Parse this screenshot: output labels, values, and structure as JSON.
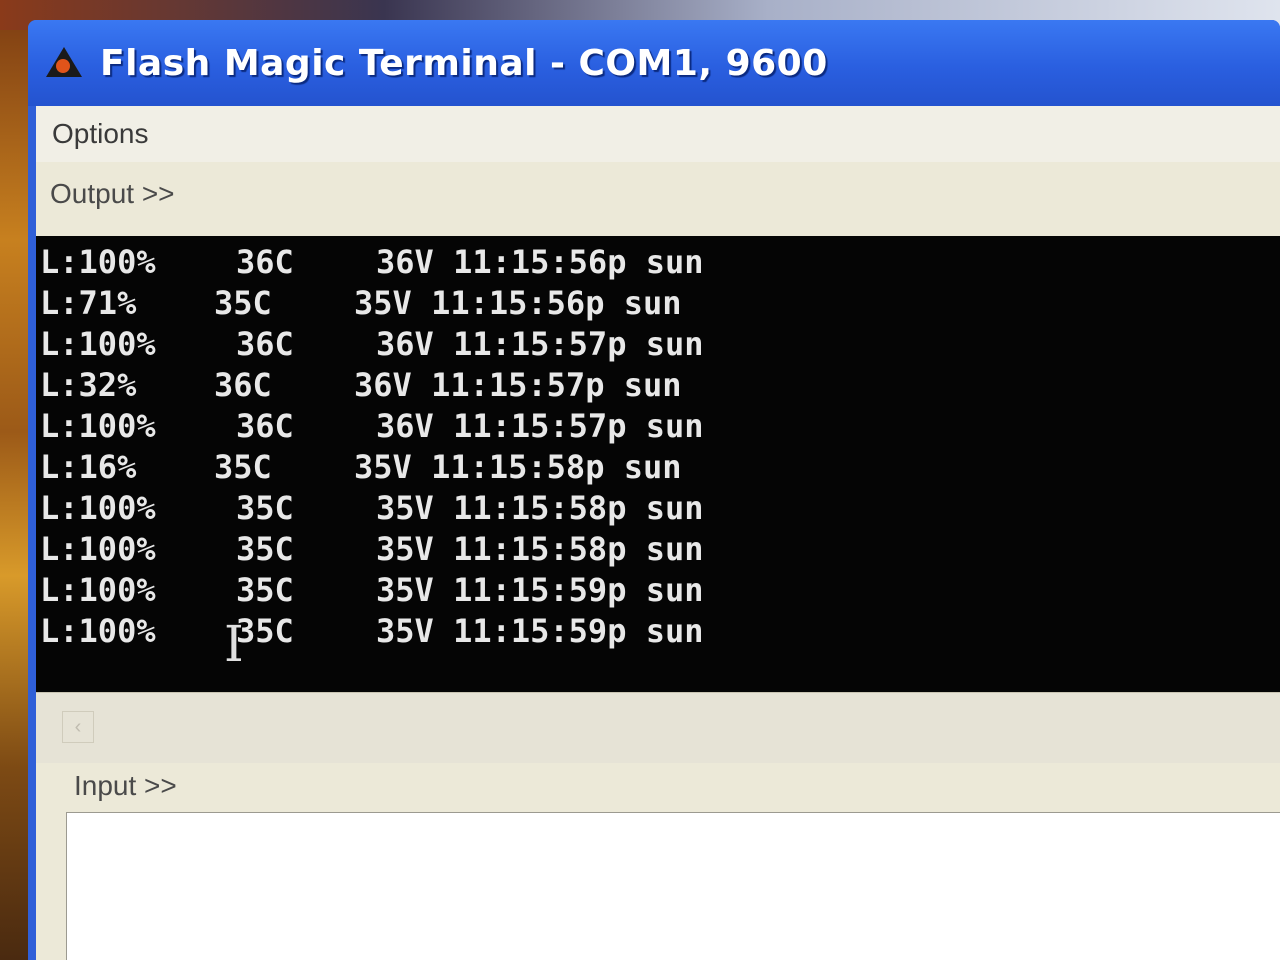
{
  "window": {
    "title": "Flash Magic Terminal - COM1, 9600",
    "icon": "flash-magic-icon"
  },
  "menu": {
    "options_label": "Options"
  },
  "output": {
    "label": "Output >>",
    "lines": [
      {
        "light": "L:100%",
        "temp": "36C",
        "volt": "36V 11:15:56p sun"
      },
      {
        "light": "L:71%",
        "temp": "35C",
        "volt": "35V 11:15:56p sun"
      },
      {
        "light": "L:100%",
        "temp": "36C",
        "volt": "36V 11:15:57p sun"
      },
      {
        "light": "L:32%",
        "temp": "36C",
        "volt": "36V 11:15:57p sun"
      },
      {
        "light": "L:100%",
        "temp": "36C",
        "volt": "36V 11:15:57p sun"
      },
      {
        "light": "L:16%",
        "temp": "35C",
        "volt": "35V 11:15:58p sun"
      },
      {
        "light": "L:100%",
        "temp": "35C",
        "volt": "35V 11:15:58p sun"
      },
      {
        "light": "L:100%",
        "temp": "35C",
        "volt": "35V 11:15:58p sun"
      },
      {
        "light": "L:100%",
        "temp": "35C",
        "volt": "35V 11:15:59p sun"
      },
      {
        "light": "L:100%",
        "temp": "35C",
        "volt": "35V 11:15:59p sun"
      }
    ]
  },
  "input": {
    "label": "Input >>",
    "value": ""
  },
  "colors": {
    "titlebar": "#2a5fe0",
    "terminal_bg": "#050505",
    "terminal_text": "#e8e8e8",
    "client_bg": "#ece9d8"
  }
}
